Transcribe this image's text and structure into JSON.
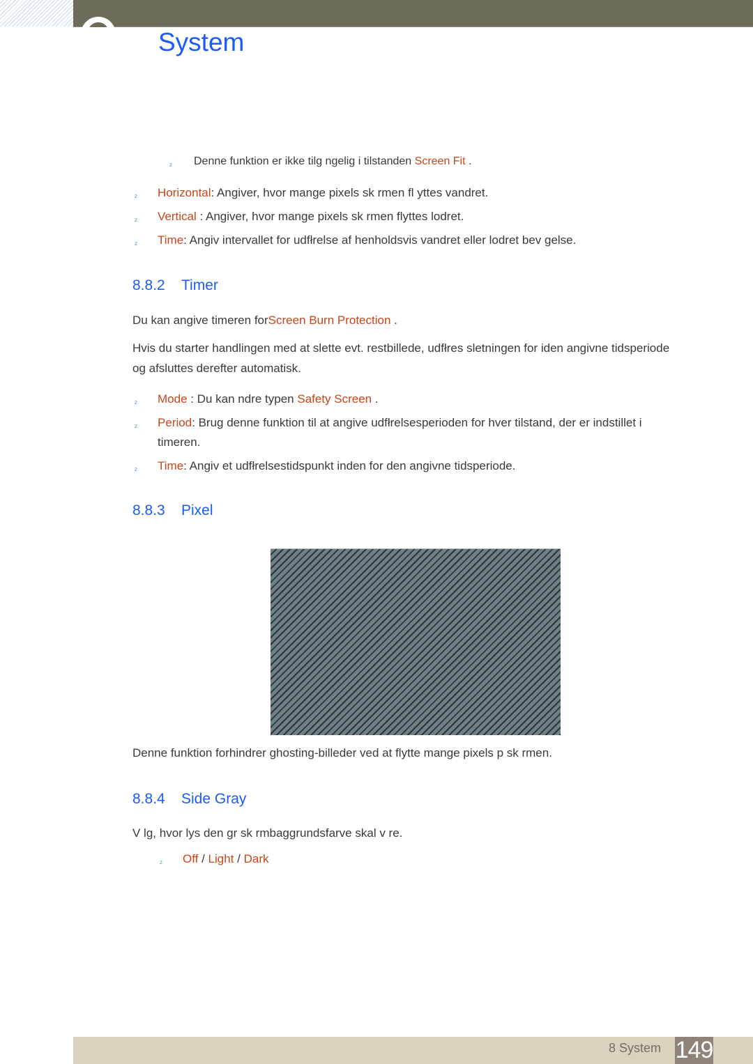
{
  "header": {
    "chapter_title": "System"
  },
  "note": {
    "text": "Denne funktion er ikke tilg ngelig i tilstanden ",
    "highlight": "Screen Fit",
    "suffix": " ."
  },
  "intro_bullets": [
    {
      "term": "Horizontal",
      "text": ": Angiver, hvor mange pixels sk rmen fl yttes vandret."
    },
    {
      "term": "Vertical",
      "text": " : Angiver, hvor mange pixels sk rmen flyttes lodret."
    },
    {
      "term": "Time",
      "text": ": Angiv intervallet for udfłrelse af henholdsvis vandret eller lodret bev gelse."
    }
  ],
  "sections": {
    "timer": {
      "number": "8.8.2",
      "title": "Timer",
      "intro_prefix": "Du kan angive timeren for",
      "intro_highlight": "Screen Burn Protection",
      "intro_suffix": "  .",
      "paragraph_line1": "Hvis du starter handlingen med at slette evt. restbillede, udfłres sletningen for iden angivne tidsperiode",
      "paragraph_line2": "og afsluttes derefter automatisk.",
      "bullets": [
        {
          "term": "Mode",
          "text": " : Du kan  ndre typen  ",
          "highlight": "Safety Screen",
          "suffix": " ."
        },
        {
          "term": "Period",
          "text": ": Brug denne funktion til at angive udfłrelsesperioden for hver tilstand, der er indstillet i",
          "continuation": "timeren."
        },
        {
          "term": "Time",
          "text": ": Angiv et udfłrelsestidspunkt inden for den angivne tidsperiode."
        }
      ]
    },
    "pixel": {
      "number": "8.8.3",
      "title": "Pixel",
      "image_label": "pixel-shift-pattern",
      "caption": "Denne funktion forhindrer ghosting-billeder ved at flytte mange pixels p  sk rmen."
    },
    "side_gray": {
      "number": "8.8.4",
      "title": "Side Gray",
      "description": "V lg, hvor lys den gr  sk rmbaggrundsfarve skal v re.",
      "options": [
        "Off",
        "Light",
        "Dark"
      ],
      "separator": " / "
    }
  },
  "footer": {
    "chapter_label": "8 System",
    "page_number": "149"
  },
  "bullet_glyph": "z",
  "colors": {
    "accent_blue": "#1a5cf5",
    "highlight_orange": "#c8461a",
    "header_bar": "#6d6c5a",
    "footer_bar": "#d8d2bf",
    "page_badge": "#8f8276"
  }
}
